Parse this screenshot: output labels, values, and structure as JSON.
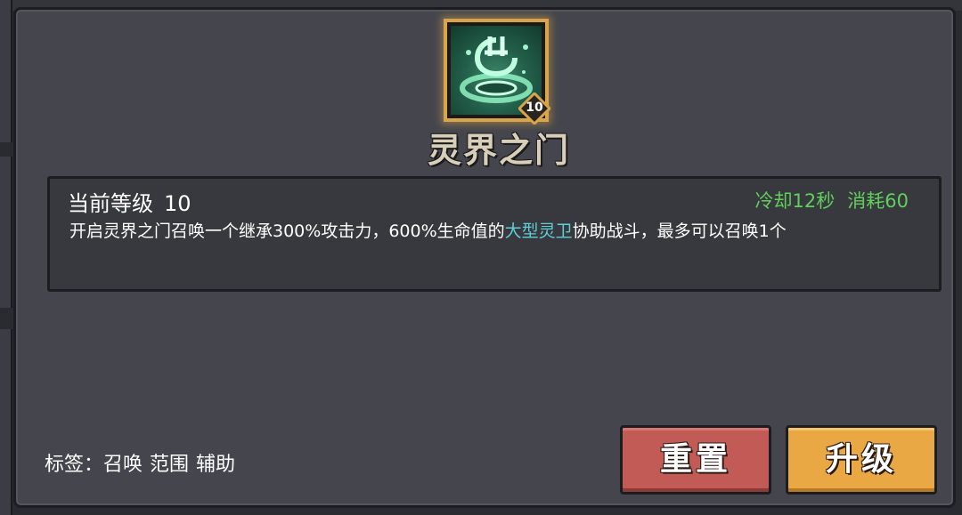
{
  "skill": {
    "name": "灵界之门",
    "icon": "spirit-gate-icon",
    "level_badge": "10"
  },
  "details": {
    "current_level_label": "当前等级",
    "current_level_value": "10",
    "cooldown": "冷却12秒",
    "cost": "消耗60",
    "description_prefix": "开启灵界之门召唤一个继承300%攻击力，600%生命值的",
    "description_highlight": "大型灵卫",
    "description_suffix": "协助战斗，最多可以召唤1个"
  },
  "tags": {
    "label": "标签：",
    "items": [
      "召唤",
      "范围",
      "辅助"
    ]
  },
  "buttons": {
    "reset": "重置",
    "upgrade": "升级"
  },
  "colors": {
    "panel_bg": "#45464d",
    "icon_border": "#d9a54a",
    "stat_green": "#5fd05a",
    "highlight_cyan": "#5ed0d4",
    "reset_red": "#c25a55",
    "upgrade_orange": "#e9a843"
  }
}
